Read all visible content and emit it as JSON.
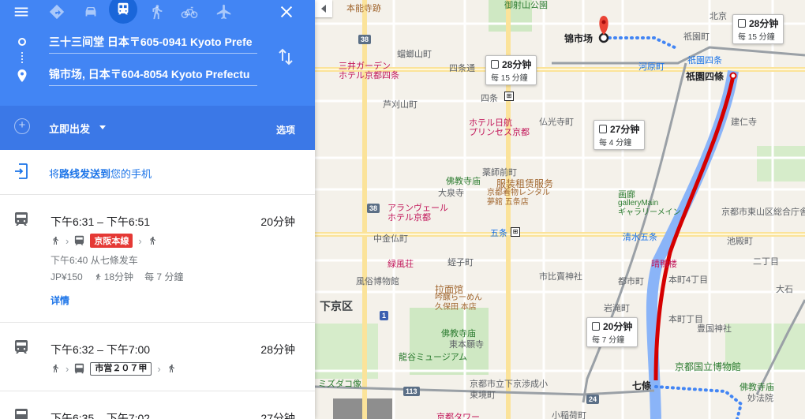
{
  "modes": {
    "menu_icon": "menu-icon",
    "best_icon": "diamond-directions-icon",
    "car_icon": "car-icon",
    "transit_icon": "transit-icon",
    "walk_icon": "walk-icon",
    "bike_icon": "bike-icon",
    "flight_icon": "flight-icon",
    "close_icon": "close-icon"
  },
  "origin": "三十三间堂 日本〒605-0941 Kyoto Prefe",
  "destination": "锦市场, 日本〒604-8054 Kyoto Prefectu",
  "depart": {
    "label": "立即出发"
  },
  "options_label": "选项",
  "send": {
    "prefix": "将",
    "bold": "路线发送到",
    "suffix": "您的手机"
  },
  "routes": [
    {
      "times": "下午6:31 – 下午6:51",
      "duration": "20分钟",
      "line": "京阪本線",
      "line_style": "red",
      "line3": "下午6:40 从七條发车",
      "fare": "JP¥150",
      "walk": "18分钟",
      "freq": "每 7 分鐘",
      "details": "详情"
    },
    {
      "times": "下午6:32 – 下午7:00",
      "duration": "28分钟",
      "line": "市営２０７甲",
      "line_style": "box"
    },
    {
      "times": "下午6:35 – 下午7:02",
      "duration": "27分钟"
    }
  ],
  "map": {
    "labels": {
      "honnoji": "本能寺跡",
      "goshoku": "御射山公園",
      "hatake": "蟷螂山町",
      "nishiki": "锦市场",
      "sanjo": "三井ガーデン\nホテル京都四条",
      "shijo_dori": "四条通",
      "shijo_st": "四条",
      "ashi": "芦刈山町",
      "kawaramachi": "河原町",
      "gion": "祇園四条",
      "gion_bold": "祇園四條",
      "gionmachi": "祇園町",
      "kenin": "建仁寺",
      "yasaka": "八坂",
      "hotel_nikko": "ホテル日航\nプリンセス京都",
      "bukko": "仏光寺町",
      "yakushi": "薬師前町",
      "fuku": "服装租赁服务",
      "fuku2": "京都着物レンタル\n夢館 五条店",
      "gallery": "画廊",
      "gallery2": "galleryMain\nギャラリーメイン",
      "kiyomizu": "清水五条",
      "gojo": "五条",
      "bukkyo1": "佛教寺庙",
      "daikyo": "大泉寺",
      "arangvel": "アランヴェール\nホテル京都",
      "nakaginzan": "中金仏町",
      "ryokufu": "緑風荘",
      "horikawa": "蛭子町",
      "rainbow": "拉面馆",
      "rainbow2": "吟醸らーめん\n久保田 本店",
      "ichimori": "市比賣神社",
      "miyako": "都市町",
      "shimogyo": "下京区",
      "tosho": "風俗博物館",
      "iwataki": "岩滝町",
      "kinhoji": "晴鴨楼",
      "bukkyo2": "佛教寺庙",
      "higashi": "東本願寺",
      "ryukoku": "龍谷ミュージアム",
      "mizudako": "ミズダコ像",
      "shichijo": "七條",
      "kokuritsu": "京都国立博物館",
      "toyokuni": "豊国神社",
      "higashiyama": "京都市東山区総合庁舎",
      "ikeno": "池殿町",
      "kokubo": "京都市立下京渉成小",
      "tokyo": "東境町",
      "kyoto_tower": "京都タワー",
      "kotaki": "小稲荷町",
      "bukkyo3": "佛教寺庙",
      "myoho": "妙法院",
      "honmachi": "本町4丁目",
      "honmachi2": "本町丁目",
      "momiji": "二丁目",
      "oishi": "大石",
      "kitakyo": "北京"
    },
    "callouts": [
      {
        "title": "28分钟",
        "sub": "每 15 分鐘"
      },
      {
        "title": "28分钟",
        "sub": "每 15 分鐘"
      },
      {
        "title": "27分钟",
        "sub": "每 4 分鐘"
      },
      {
        "title": "20分钟",
        "sub": "每 7 分鐘"
      }
    ],
    "shields": [
      "38",
      "38",
      "113",
      "24",
      "1"
    ]
  }
}
